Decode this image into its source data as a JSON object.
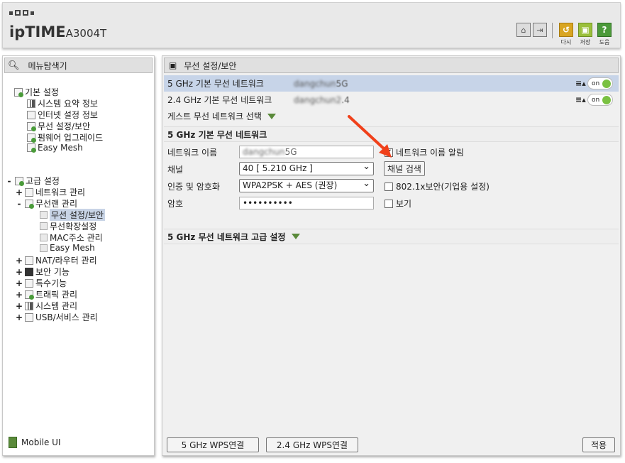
{
  "header": {
    "brand": "ipTIME",
    "model": "A3004T",
    "buttons": {
      "home": "home-icon",
      "logout": "logout-icon",
      "redo_label": "다시",
      "save_label": "저장",
      "help_label": "도움"
    },
    "colors": {
      "redo": "#d9a521",
      "save": "#9bc03c",
      "help": "#4c9a3a"
    }
  },
  "sidebar": {
    "title": "메뉴탐색기",
    "basic": {
      "label": "기본 설정",
      "items": [
        "시스템 요약 정보",
        "인터넷 설정 정보",
        "무선 설정/보안",
        "펌웨어 업그레이드",
        "Easy Mesh"
      ]
    },
    "advanced": {
      "label": "고급 설정",
      "items": [
        {
          "pm": "+",
          "label": "네트워크 관리"
        },
        {
          "pm": "-",
          "label": "무선랜 관리"
        }
      ],
      "wireless_sub": [
        "무선 설정/보안",
        "무선확장설정",
        "MAC주소 관리",
        "Easy Mesh"
      ],
      "more": [
        {
          "pm": "+",
          "label": "NAT/라우터 관리"
        },
        {
          "pm": "+",
          "label": "보안 기능"
        },
        {
          "pm": "+",
          "label": "특수기능"
        },
        {
          "pm": "+",
          "label": "트래픽 관리"
        },
        {
          "pm": "+",
          "label": "시스템 관리"
        },
        {
          "pm": "+",
          "label": "USB/서비스 관리"
        }
      ]
    },
    "mobile": "Mobile UI"
  },
  "main": {
    "title": "무선 설정/보안",
    "networks": [
      {
        "label": "5 GHz 기본 무선 네트워크",
        "ssid_blur": "dangchun",
        "ssid_suffix": "5G",
        "toggle": "on"
      },
      {
        "label": "2.4 GHz 기본 무선 네트워크",
        "ssid_blur": "dangchun2",
        "ssid_suffix": ".4",
        "toggle": "on"
      }
    ],
    "guest_label": "게스트 무선 네트워크 선택",
    "section_5g": "5 GHz 기본 무선 네트워크",
    "form": {
      "ssid_label": "네트워크 이름",
      "ssid_blur": "dangchun",
      "ssid_suffix": "5G",
      "broadcast_label": "네트워크 이름 알림",
      "channel_label": "채널",
      "channel_value": "40 [ 5.210 GHz ]",
      "channel_search": "채널 검색",
      "auth_label": "인증 및 암호화",
      "auth_value": "WPA2PSK + AES (권장)",
      "dot1x_label": "802.1x보안(기업용 설정)",
      "password_label": "암호",
      "password_value": "••••••••••",
      "show_label": "보기"
    },
    "advanced_5g": "5 GHz 무선 네트워크 고급 설정",
    "footer": {
      "wps5": "5 GHz WPS연결",
      "wps24": "2.4 GHz WPS연결",
      "apply": "적용"
    }
  }
}
